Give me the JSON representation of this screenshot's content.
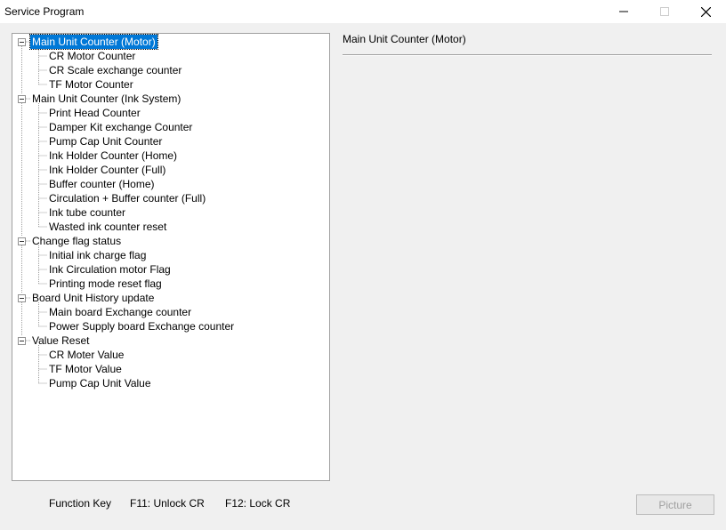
{
  "window": {
    "title": "Service Program",
    "minimize_glyph": "—",
    "maximize_glyph": "☐",
    "close_glyph": "✕"
  },
  "tree": {
    "groups": [
      {
        "label": "Main Unit Counter (Motor)",
        "selected": true,
        "children": [
          "CR Motor Counter",
          "CR Scale exchange counter",
          "TF Motor Counter"
        ]
      },
      {
        "label": "Main Unit Counter (Ink System)",
        "selected": false,
        "children": [
          "Print Head Counter",
          "Damper Kit exchange Counter",
          "Pump Cap Unit Counter",
          "Ink Holder Counter (Home)",
          "Ink Holder Counter (Full)",
          "Buffer counter (Home)",
          "Circulation + Buffer counter (Full)",
          "Ink tube counter",
          "Wasted ink counter reset"
        ]
      },
      {
        "label": "Change flag status",
        "selected": false,
        "children": [
          "Initial ink charge flag",
          "Ink Circulation motor Flag",
          "Printing mode reset flag"
        ]
      },
      {
        "label": "Board Unit History update",
        "selected": false,
        "children": [
          "Main board  Exchange counter",
          "Power Supply board  Exchange counter"
        ]
      },
      {
        "label": "Value Reset",
        "selected": false,
        "children": [
          "CR Moter Value",
          "TF Motor Value",
          "Pump Cap Unit Value"
        ]
      }
    ]
  },
  "detail": {
    "title": "Main Unit Counter (Motor)"
  },
  "footer": {
    "function_key_label": "Function Key",
    "f11_label": "F11: Unlock CR",
    "f12_label": "F12: Lock CR",
    "picture_button": "Picture"
  }
}
